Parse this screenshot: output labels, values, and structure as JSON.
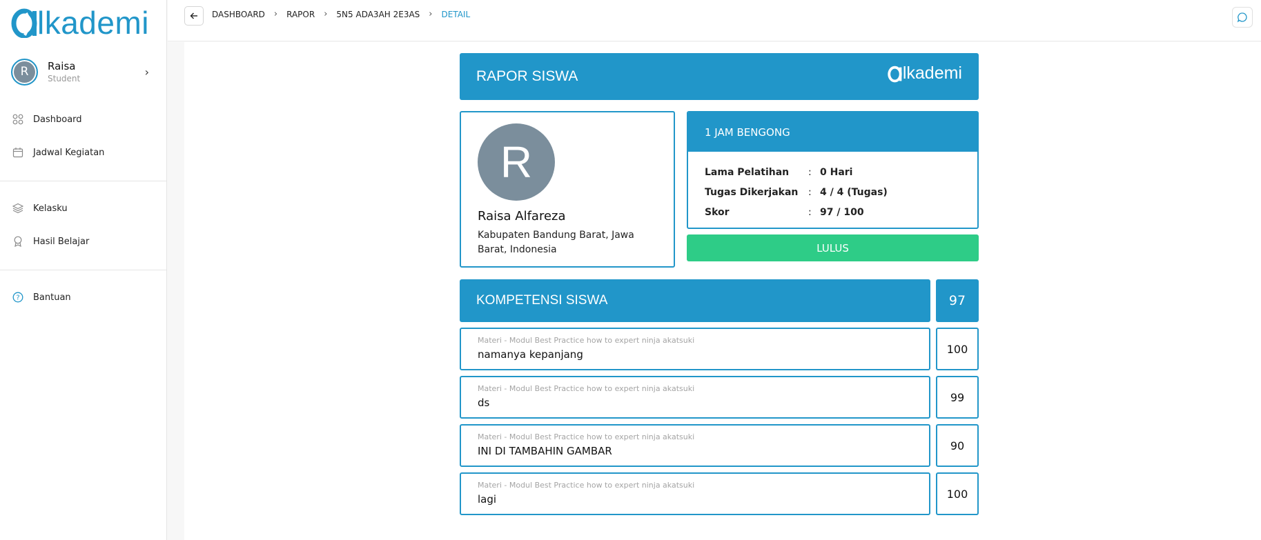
{
  "brand": {
    "name": "lkademi",
    "color": "#2196c9",
    "success_color": "#2ecc87"
  },
  "user": {
    "initial": "R",
    "name": "Raisa",
    "role": "Student"
  },
  "sidebar": {
    "items": [
      {
        "label": "Dashboard",
        "icon": "grid-icon"
      },
      {
        "label": "Jadwal Kegiatan",
        "icon": "calendar-icon"
      },
      {
        "label": "Kelasku",
        "icon": "layers-icon"
      },
      {
        "label": "Hasil Belajar",
        "icon": "award-icon"
      },
      {
        "label": "Bantuan",
        "icon": "help-circle-icon"
      }
    ]
  },
  "breadcrumb": [
    "DASHBOARD",
    "RAPOR",
    "5N5 ADA3AH 2E3AS",
    "DETAIL"
  ],
  "report": {
    "title": "RAPOR SISWA",
    "logo_text": "lkademi",
    "student": {
      "initial": "R",
      "name": "Raisa Alfareza",
      "location": "Kabupaten Bandung Barat, Jawa Barat, Indonesia"
    },
    "course": {
      "name": "1 JAM BENGONG",
      "rows": [
        {
          "key": "Lama Pelatihan",
          "value": "0 Hari"
        },
        {
          "key": "Tugas Dikerjakan",
          "value": "4 / 4 (Tugas)"
        },
        {
          "key": "Skor",
          "value": "97 / 100"
        }
      ]
    },
    "status": "LULUS"
  },
  "competency": {
    "title": "KOMPETENSI SISWA",
    "total": "97",
    "items": [
      {
        "module": "Materi - Modul Best Practice how to expert ninja akatsuki",
        "name": "namanya kepanjang",
        "score": "100"
      },
      {
        "module": "Materi - Modul Best Practice how to expert ninja akatsuki",
        "name": "ds",
        "score": "99"
      },
      {
        "module": "Materi - Modul Best Practice how to expert ninja akatsuki",
        "name": "INI DI TAMBAHIN GAMBAR",
        "score": "90"
      },
      {
        "module": "Materi - Modul Best Practice how to expert ninja akatsuki",
        "name": "lagi",
        "score": "100"
      }
    ]
  }
}
